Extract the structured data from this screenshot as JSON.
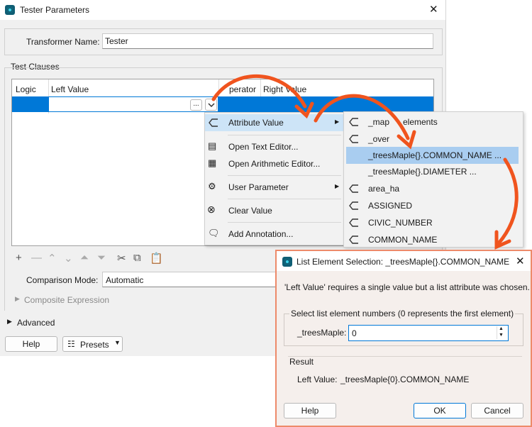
{
  "main": {
    "title": "Tester Parameters",
    "transformer_name_label": "Transformer Name:",
    "transformer_name_value": "Tester",
    "test_clauses_label": "Test Clauses",
    "columns": [
      "Logic",
      "Left Value",
      "Operator",
      "Right Value"
    ],
    "operator_visible": "perator",
    "ellipsis_label": "...",
    "comparison_mode_label": "Comparison Mode:",
    "comparison_mode_value": "Automatic",
    "composite_label": "Composite Expression",
    "advanced_label": "Advanced",
    "help_label": "Help",
    "presets_label": "Presets"
  },
  "context_menu": {
    "items": [
      {
        "label": "Attribute Value",
        "icon": "attribute-tag-icon",
        "submenu": true
      },
      {
        "label": "Open Text Editor...",
        "icon": "text-editor-icon"
      },
      {
        "label": "Open Arithmetic Editor...",
        "icon": "calculator-icon"
      },
      {
        "label": "User Parameter",
        "icon": "user-parameter-icon",
        "submenu": true
      },
      {
        "label": "Clear Value",
        "icon": "clear-circle-x-icon"
      },
      {
        "label": "Add Annotation...",
        "icon": "annotation-icon"
      }
    ]
  },
  "attribute_menu": {
    "items": [
      {
        "label": "_map_elements",
        "visible_label": "_map",
        "tail": "elements"
      },
      {
        "label": "_over",
        "visible_label": "_over"
      },
      {
        "label": "_treesMaple{}.COMMON_NAME ..."
      },
      {
        "label": "_treesMaple{}.DIAMETER ..."
      },
      {
        "label": "area_ha"
      },
      {
        "label": "ASSIGNED"
      },
      {
        "label": "CIVIC_NUMBER"
      },
      {
        "label": "COMMON_NAME"
      }
    ]
  },
  "dialog": {
    "title": "List Element Selection: _treesMaple{}.COMMON_NAME",
    "message": "'Left Value' requires a single value but a list attribute was chosen.",
    "group_label": "Select list element numbers (0 represents the first element)",
    "field_label": "_treesMaple:",
    "field_value": "0",
    "result_label": "Result",
    "result_prefix": "Left Value:",
    "result_value": "_treesMaple{0}.COMMON_NAME",
    "help_label": "Help",
    "ok_label": "OK",
    "cancel_label": "Cancel"
  },
  "colors": {
    "selection": "#0078d7",
    "menu_highlight": "#cde4f7",
    "annotation_arrow": "#f0541e",
    "dialog_border": "#ed8a6a"
  }
}
